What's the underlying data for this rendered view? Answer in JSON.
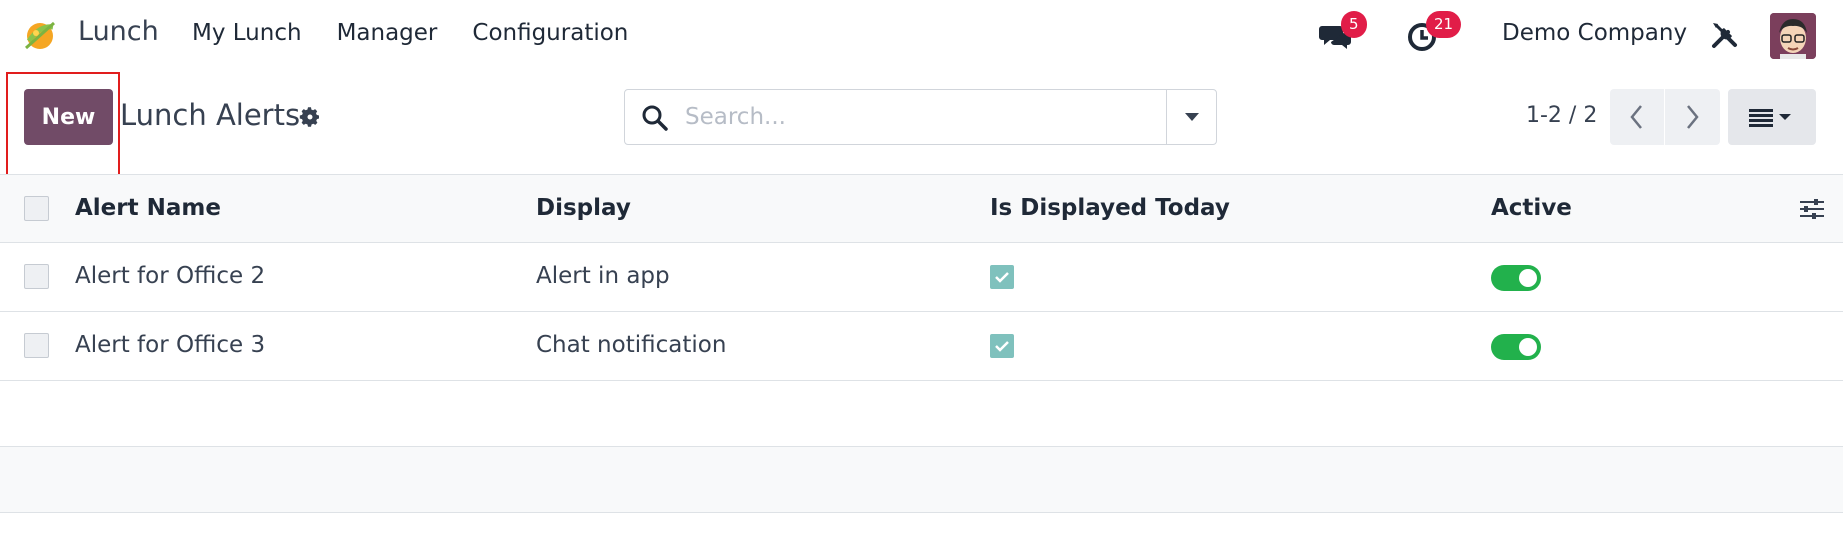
{
  "navbar": {
    "app_name": "Lunch",
    "menu": [
      "My Lunch",
      "Manager",
      "Configuration"
    ],
    "chat_badge": "5",
    "activity_badge": "21",
    "company": "Demo Company"
  },
  "control_panel": {
    "new_label": "New",
    "title": "Lunch Alerts",
    "search_placeholder": "Search...",
    "pager": "1-2 / 2"
  },
  "table": {
    "columns": [
      "Alert Name",
      "Display",
      "Is Displayed Today",
      "Active"
    ],
    "rows": [
      {
        "name": "Alert for Office 2",
        "display": "Alert in app",
        "displayed_today": true,
        "active": true
      },
      {
        "name": "Alert for Office 3",
        "display": "Chat notification",
        "displayed_today": true,
        "active": true
      }
    ]
  },
  "colors": {
    "brand": "#714b67",
    "badge": "#e11d48",
    "toggle_on": "#22b14c",
    "check": "#7fc1bd",
    "highlight": "#e11d1d"
  },
  "icons": [
    "app-logo-icon",
    "chat-icon",
    "activity-clock-icon",
    "tools-icon",
    "gear-icon",
    "search-icon",
    "caret-down-icon",
    "chevron-left-icon",
    "chevron-right-icon",
    "list-view-icon",
    "optional-columns-icon"
  ]
}
